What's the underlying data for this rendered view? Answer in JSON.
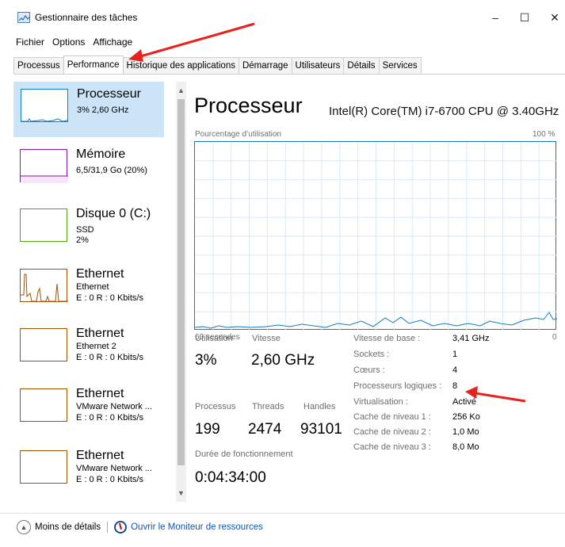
{
  "window": {
    "title": "Gestionnaire des tâches",
    "minimize": "–",
    "maximize": "☐",
    "close": "✕"
  },
  "menu": [
    "Fichier",
    "Options",
    "Affichage"
  ],
  "tabs": [
    "Processus",
    "Performance",
    "Historique des applications",
    "Démarrage",
    "Utilisateurs",
    "Détails",
    "Services"
  ],
  "active_tab": "Performance",
  "sidebar": {
    "items": [
      {
        "title": "Processeur",
        "sub1": "3% 2,60 GHz",
        "sub2": "",
        "sub3": "",
        "color": "#117dbb"
      },
      {
        "title": "Mémoire",
        "sub1": "6,5/31,9 Go (20%)",
        "sub2": "",
        "sub3": "",
        "color": "#8b12ae"
      },
      {
        "title": "Disque 0 (C:)",
        "sub1": "SSD",
        "sub2": "2%",
        "sub3": "",
        "color": "#4da60c"
      },
      {
        "title": "Ethernet",
        "sub1": "Ethernet",
        "sub2": "E : 0 R : 0 Kbits/s",
        "sub3": "",
        "color": "#a74f01"
      },
      {
        "title": "Ethernet",
        "sub1": "Ethernet 2",
        "sub2": "E : 0 R : 0 Kbits/s",
        "sub3": "",
        "color": "#a74f01"
      },
      {
        "title": "Ethernet",
        "sub1": "VMware Network ...",
        "sub2": "E : 0 R : 0 Kbits/s",
        "sub3": "",
        "color": "#a74f01"
      },
      {
        "title": "Ethernet",
        "sub1": "VMware Network ...",
        "sub2": "E : 0 R : 0 Kbits/s",
        "sub3": "",
        "color": "#a74f01"
      }
    ]
  },
  "main": {
    "title": "Processeur",
    "cpu_name": "Intel(R) Core(TM) i7-6700 CPU @ 3.40GHz",
    "chart_label": "Pourcentage d’utilisation",
    "chart_max": "100 %",
    "time_label": "60 secondes",
    "time_zero": "0",
    "stats": {
      "utilisation_label": "Utilisation",
      "utilisation_value": "3%",
      "vitesse_label": "Vitesse",
      "vitesse_value": "2,60 GHz",
      "processus_label": "Processus",
      "processus_value": "199",
      "threads_label": "Threads",
      "threads_value": "2474",
      "handles_label": "Handles",
      "handles_value": "93101",
      "uptime_label": "Durée de fonctionnement",
      "uptime_value": "0:04:34:00"
    },
    "specs": [
      {
        "label": "Vitesse de base :",
        "value": "3,41 GHz"
      },
      {
        "label": "Sockets :",
        "value": "1"
      },
      {
        "label": "Cœurs :",
        "value": "4"
      },
      {
        "label": "Processeurs logiques :",
        "value": "8"
      },
      {
        "label": "Virtualisation :",
        "value": "Activé"
      },
      {
        "label": "Cache de niveau 1 :",
        "value": "256 Ko"
      },
      {
        "label": "Cache de niveau 2 :",
        "value": "1,0 Mo"
      },
      {
        "label": "Cache de niveau 3 :",
        "value": "8,0 Mo"
      }
    ]
  },
  "footer": {
    "less_details": "Moins de détails",
    "open_monitor": "Ouvrir le Moniteur de ressources"
  },
  "colors": {
    "accent": "#117dbb",
    "annotation": "#e8211c"
  }
}
